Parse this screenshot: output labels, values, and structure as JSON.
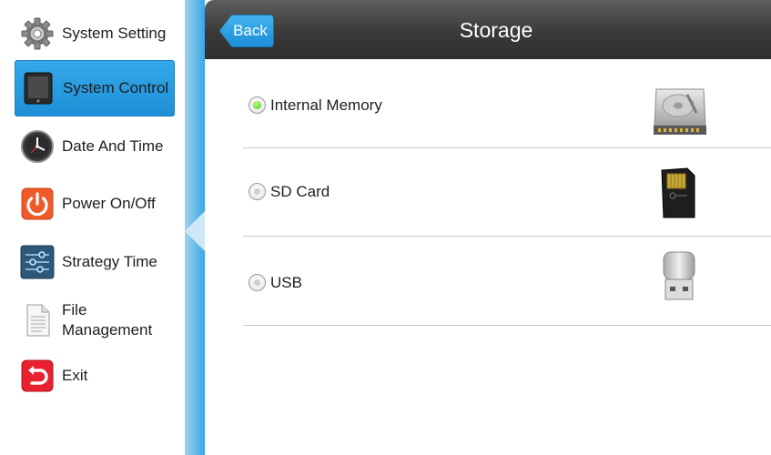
{
  "sidebar": {
    "items": [
      {
        "label": "System Setting",
        "icon": "gear-icon",
        "active": false
      },
      {
        "label": "System Control",
        "icon": "tablet-icon",
        "active": true
      },
      {
        "label": "Date And Time",
        "icon": "clock-icon",
        "active": false
      },
      {
        "label": "Power On/Off",
        "icon": "power-icon",
        "active": false
      },
      {
        "label": "Strategy Time",
        "icon": "sliders-icon",
        "active": false
      },
      {
        "label": "File Management",
        "icon": "document-icon",
        "active": false
      },
      {
        "label": "Exit",
        "icon": "exit-icon",
        "active": false
      }
    ]
  },
  "header": {
    "back_label": "Back",
    "title": "Storage"
  },
  "storage": {
    "options": [
      {
        "label": "Internal Memory",
        "icon": "hard-drive-icon",
        "selected": true
      },
      {
        "label": "SD Card",
        "icon": "sd-card-icon",
        "selected": false
      },
      {
        "label": "USB",
        "icon": "usb-drive-icon",
        "selected": false
      }
    ]
  },
  "colors": {
    "accent": "#1e8fd6",
    "topbar": "#3a3a3a",
    "selected_radio": "#47c41b"
  }
}
